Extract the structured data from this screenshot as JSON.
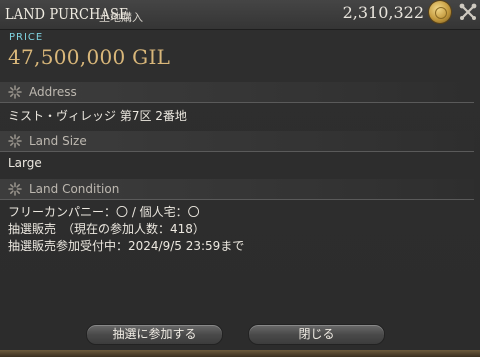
{
  "window": {
    "title": "LAND PURCHASE",
    "subtitle": "土地購入",
    "gil_balance": "2,310,322"
  },
  "price": {
    "label": "PRICE",
    "value": "47,500,000 GIL"
  },
  "sections": {
    "address": {
      "header": "Address",
      "value": "ミスト・ヴィレッジ 第7区 2番地"
    },
    "land_size": {
      "header": "Land Size",
      "value": "Large"
    },
    "land_condition": {
      "header": "Land Condition",
      "lines": [
        "フリーカンパニー：〇 / 個人宅：〇",
        "抽選販売　（現在の参加人数：418）",
        "抽選販売参加受付中：2024/9/5 23:59まで"
      ]
    }
  },
  "buttons": {
    "enter_lottery": "抽選に参加する",
    "close": "閉じる"
  },
  "colors": {
    "price_label": "#7fd3e0",
    "price_value": "#d9b77a"
  },
  "icons": {
    "gil": "gil-coin-icon",
    "settings": "crossed-tools-icon",
    "section": "sparkle-icon"
  }
}
